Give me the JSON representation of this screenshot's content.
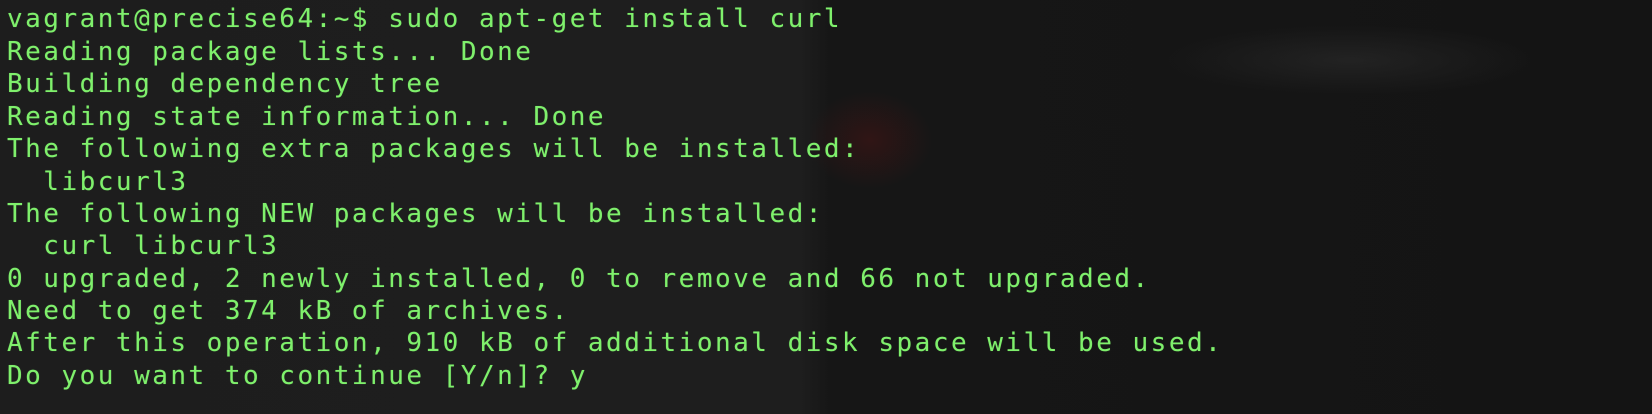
{
  "terminal": {
    "lines": [
      "vagrant@precise64:~$ sudo apt-get install curl",
      "Reading package lists... Done",
      "Building dependency tree",
      "Reading state information... Done",
      "The following extra packages will be installed:",
      "  libcurl3",
      "The following NEW packages will be installed:",
      "  curl libcurl3",
      "0 upgraded, 2 newly installed, 0 to remove and 66 not upgraded.",
      "Need to get 374 kB of archives.",
      "After this operation, 910 kB of additional disk space will be used.",
      "Do you want to continue [Y/n]? y"
    ]
  },
  "colors": {
    "text": "#7ff06c",
    "background": "#1b1b1b"
  }
}
